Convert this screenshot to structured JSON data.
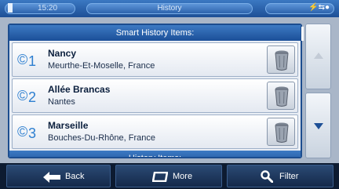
{
  "status_bar": {
    "time": "15:20",
    "title": "History",
    "signal": "⚡⇆●"
  },
  "smart_section": {
    "header": "Smart History Items:"
  },
  "items": [
    {
      "index": "1",
      "title": "Nancy",
      "subtitle": "Meurthe-Et-Moselle, France"
    },
    {
      "index": "2",
      "title": "Allée Brancas",
      "subtitle": "Nantes"
    },
    {
      "index": "3",
      "title": "Marseille",
      "subtitle": "Bouches-Du-Rhône, France"
    }
  ],
  "history_section": {
    "header": "History Items:"
  },
  "icons": {
    "item_icon": "history-pin-icon",
    "delete_icon": "trash-icon",
    "scroll_up": "chevron-up-icon",
    "scroll_down": "chevron-down-icon",
    "back": "arrow-left-icon",
    "more": "more-icon",
    "filter": "search-icon"
  },
  "toolbar": {
    "back_label": "Back",
    "more_label": "More",
    "filter_label": "Filter"
  },
  "colors": {
    "accent": "#1b4f98",
    "panel": "#a9b6c8",
    "toolbar": "#0d1b31"
  }
}
